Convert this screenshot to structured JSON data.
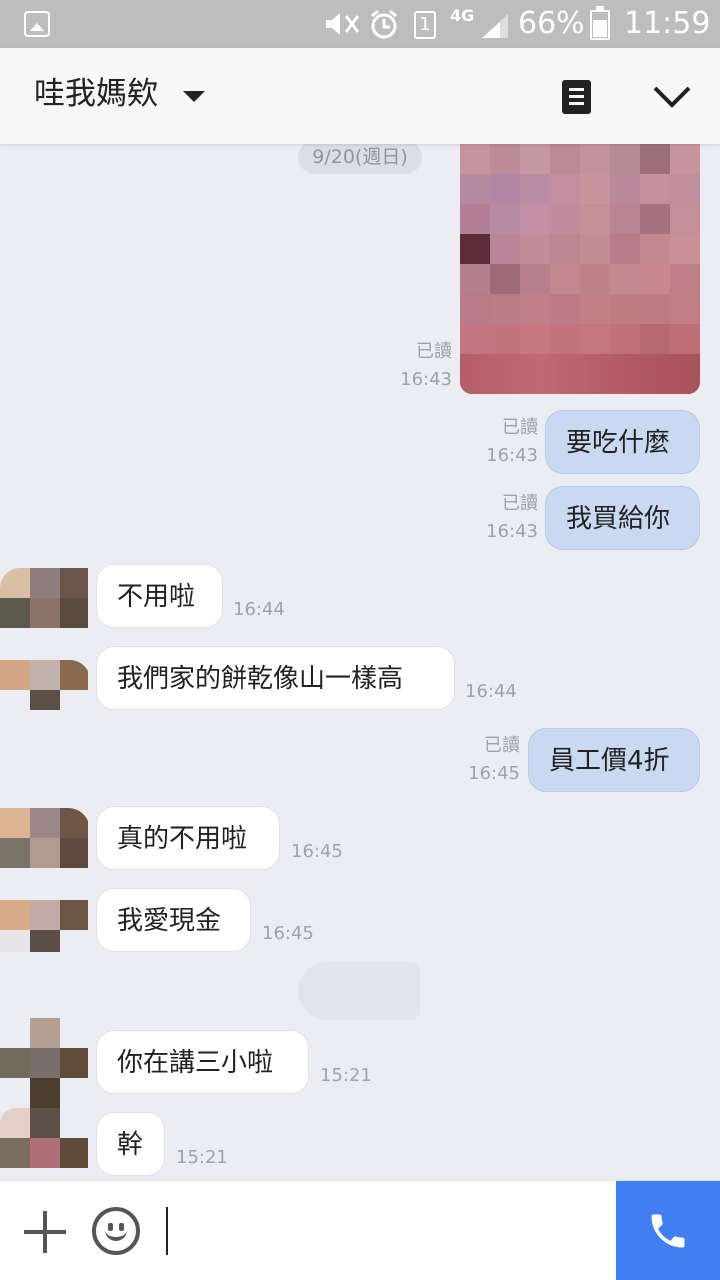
{
  "status_bar": {
    "battery": "66%",
    "time": "11:59",
    "sim": "1",
    "network": "4G"
  },
  "header": {
    "title": "哇我媽欸"
  },
  "chat": {
    "date": "9/20(週日)",
    "photo_read": "已讀",
    "photo_time": "16:43",
    "messages": [
      {
        "dir": "out",
        "text": "要吃什麼",
        "read": "已讀",
        "time": "16:43"
      },
      {
        "dir": "out",
        "text": "我買給你",
        "read": "已讀",
        "time": "16:43"
      },
      {
        "dir": "in",
        "text": "不用啦",
        "time": "16:44"
      },
      {
        "dir": "in",
        "text": "我們家的餅乾像山一樣高",
        "time": "16:44"
      },
      {
        "dir": "out",
        "text": "員工價4折",
        "read": "已讀",
        "time": "16:45"
      },
      {
        "dir": "in",
        "text": "真的不用啦",
        "time": "16:45"
      },
      {
        "dir": "in",
        "text": "我愛現金",
        "time": "16:45"
      },
      {
        "dir": "in",
        "text": "你在講三小啦",
        "time": "15:21"
      },
      {
        "dir": "in",
        "text": "幹",
        "time": "15:21"
      }
    ]
  },
  "colors": {
    "chat_bg": "#ecedf2",
    "outgoing_bubble": "#cad9f2",
    "incoming_bubble": "#ffffff",
    "call_button": "#3f7ef3"
  },
  "icons": {
    "status_left": "image-icon",
    "header_right_1": "notes-icon",
    "header_right_2": "chevron-down-icon",
    "input_left_1": "plus-icon",
    "input_left_2": "emoji-icon",
    "input_right": "phone-icon"
  }
}
